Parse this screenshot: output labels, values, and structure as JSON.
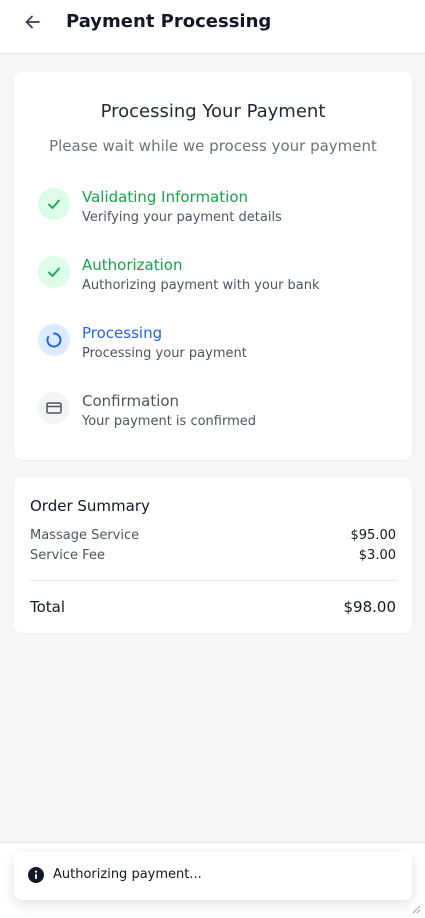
{
  "header": {
    "title": "Payment Processing",
    "back_icon": "arrow-left-icon"
  },
  "processing": {
    "title": "Processing Your Payment",
    "subtitle": "Please wait while we process your payment",
    "steps": [
      {
        "title": "Validating Information",
        "description": "Verifying your payment details",
        "status": "complete",
        "icon": "check-icon"
      },
      {
        "title": "Authorization",
        "description": "Authorizing payment with your bank",
        "status": "complete",
        "icon": "check-icon"
      },
      {
        "title": "Processing",
        "description": "Processing your payment",
        "status": "active",
        "icon": "spinner-icon"
      },
      {
        "title": "Confirmation",
        "description": "Your payment is confirmed",
        "status": "pending",
        "icon": "credit-card-icon"
      }
    ]
  },
  "order_summary": {
    "title": "Order Summary",
    "items": [
      {
        "label": "Massage Service",
        "amount": "$95.00"
      },
      {
        "label": "Service Fee",
        "amount": "$3.00"
      }
    ],
    "total_label": "Total",
    "total_amount": "$98.00"
  },
  "toast": {
    "message": "Authorizing payment...",
    "icon": "info-icon"
  },
  "colors": {
    "complete": "#16a34a",
    "complete_bg": "#dcfce7",
    "active": "#2563eb",
    "active_bg": "#dbeafe",
    "pending": "#4b5563",
    "pending_bg": "#f3f4f6"
  }
}
